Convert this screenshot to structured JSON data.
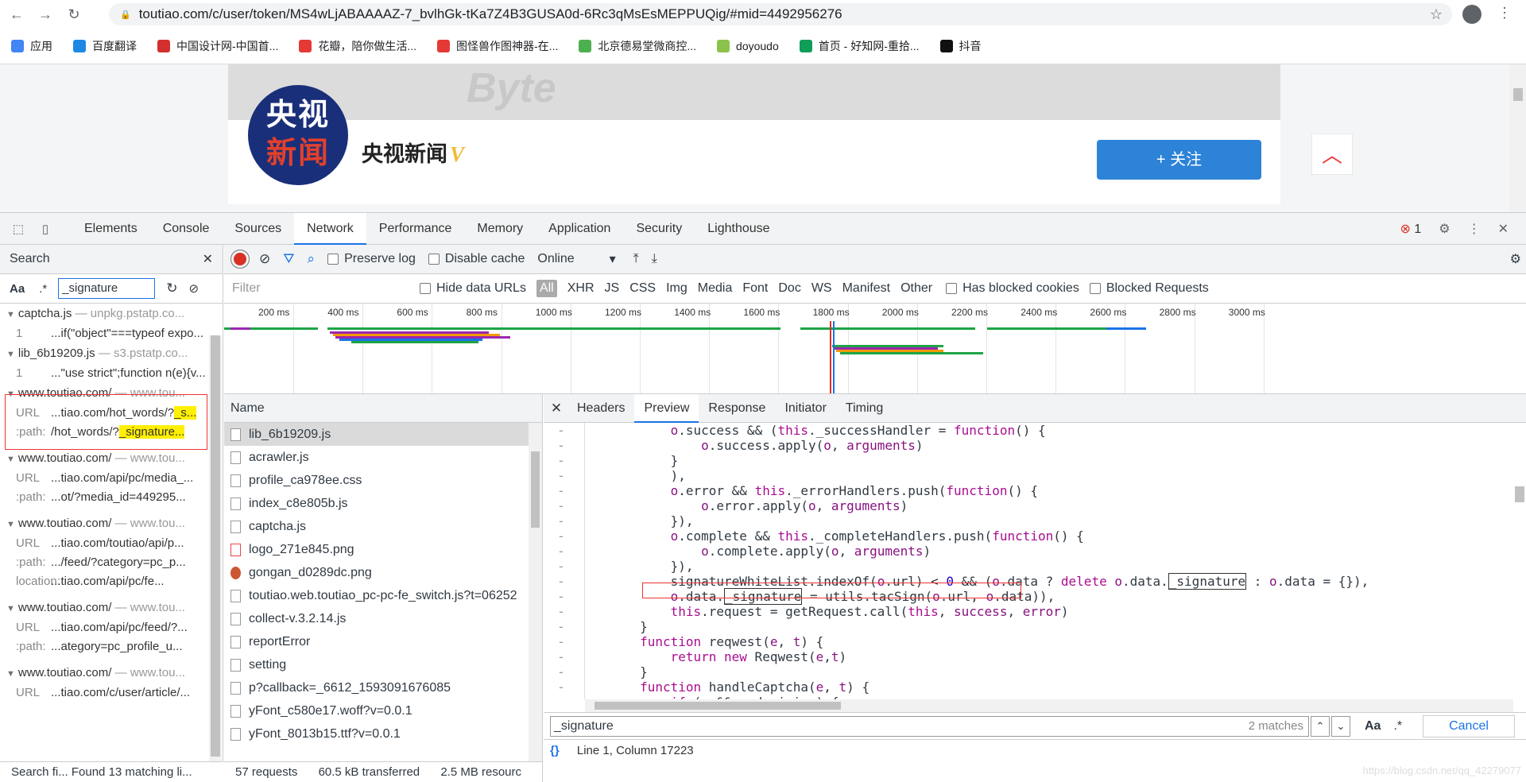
{
  "browser": {
    "url": "toutiao.com/c/user/token/MS4wLjABAAAAZ-7_bvlhGk-tKa7Z4B3GUSA0d-6Rc3qMsEsMEPPUQig/#mid=4492956276",
    "bookmarks": [
      "应用",
      "百度翻译",
      "中国设计网-中国首...",
      "花瓣，陪你做生活...",
      "图怪兽作图神器-在...",
      "北京德易堂微商控...",
      "doyoudo",
      "首页 - 好知网-重拾...",
      "抖音"
    ],
    "bookmark_colors": [
      "#4285f4",
      "#1e88e5",
      "#d32f2f",
      "#e53935",
      "#e53935",
      "#4caf50",
      "#8bc34a",
      "#0f9d58",
      "#111111"
    ]
  },
  "page": {
    "banner_wm": "Byte",
    "logo": {
      "line1": "央视",
      "line2": "新闻"
    },
    "account_name": "央视新闻",
    "verified": "V",
    "follow_label": "+ 关注",
    "top_icon": "chevron-up-icon"
  },
  "devtools": {
    "tabs": [
      "Elements",
      "Console",
      "Sources",
      "Network",
      "Performance",
      "Memory",
      "Application",
      "Security",
      "Lighthouse"
    ],
    "active_tab": "Network",
    "error_count": "1",
    "search": {
      "title": "Search",
      "aa": "Aa",
      "regex": ".*",
      "query": "_signature",
      "status": "Search fi...   Found 13 matching li...",
      "results": [
        {
          "file": "captcha.js",
          "src": "— unpkg.pstatp.co...",
          "lines": [
            {
              "k": "1",
              "v": "...if(\"object\"===typeof expo..."
            }
          ]
        },
        {
          "file": "lib_6b19209.js",
          "src": "— s3.pstatp.co...",
          "lines": [
            {
              "k": "1",
              "v": "...\"use strict\";function n(e){v..."
            }
          ]
        },
        {
          "file": "www.toutiao.com/",
          "src": "— www.tou...",
          "lines": [
            {
              "k": "URL",
              "v": "...tiao.com/hot_words/?",
              "h": "_s..."
            },
            {
              "k": ":path:",
              "v": "/hot_words/?",
              "h": "_signature..."
            }
          ]
        },
        {
          "file": "www.toutiao.com/",
          "src": "— www.tou...",
          "lines": [
            {
              "k": "URL",
              "v": "...tiao.com/api/pc/media_..."
            },
            {
              "k": ":path:",
              "v": "...ot/?media_id=449295..."
            }
          ]
        },
        {
          "file": "www.toutiao.com/",
          "src": "— www.tou...",
          "lines": [
            {
              "k": "URL",
              "v": "...tiao.com/toutiao/api/p..."
            },
            {
              "k": ":path:",
              "v": ".../feed/?category=pc_p..."
            },
            {
              "k": "location:",
              "v": "...tiao.com/api/pc/fe..."
            }
          ]
        },
        {
          "file": "www.toutiao.com/",
          "src": "— www.tou...",
          "lines": [
            {
              "k": "URL",
              "v": "...tiao.com/api/pc/feed/?..."
            },
            {
              "k": ":path:",
              "v": "...ategory=pc_profile_u..."
            }
          ]
        },
        {
          "file": "www.toutiao.com/",
          "src": "— www.tou...",
          "lines": [
            {
              "k": "URL",
              "v": "...tiao.com/c/user/article/..."
            }
          ]
        }
      ]
    },
    "network": {
      "preserve_log": "Preserve log",
      "disable_cache": "Disable cache",
      "throttle": "Online",
      "filter_placeholder": "Filter",
      "hide_data_urls": "Hide data URLs",
      "filters": [
        "All",
        "XHR",
        "JS",
        "CSS",
        "Img",
        "Media",
        "Font",
        "Doc",
        "WS",
        "Manifest",
        "Other"
      ],
      "has_blocked": "Has blocked cookies",
      "blocked_requests": "Blocked Requests",
      "ticks": [
        "200 ms",
        "400 ms",
        "600 ms",
        "800 ms",
        "1000 ms",
        "1200 ms",
        "1400 ms",
        "1600 ms",
        "1800 ms",
        "2000 ms",
        "2200 ms",
        "2400 ms",
        "2600 ms",
        "2800 ms",
        "3000 ms"
      ],
      "name_header": "Name",
      "requests": [
        "lib_6b19209.js",
        "acrawler.js",
        "profile_ca978ee.css",
        "index_c8e805b.js",
        "captcha.js",
        "logo_271e845.png",
        "gongan_d0289dc.png",
        "toutiao.web.toutiao_pc-pc-fe_switch.js?t=06252",
        "collect-v.3.2.14.js",
        "reportError",
        "setting",
        "p?callback=_6612_1593091676085",
        "yFont_c580e17.woff?v=0.0.1",
        "yFont_8013b15.ttf?v=0.0.1"
      ],
      "status": {
        "requests": "57 requests",
        "transferred": "60.5 kB transferred",
        "resources": "2.5 MB resourc"
      },
      "preview_tabs": [
        "Headers",
        "Preview",
        "Response",
        "Initiator",
        "Timing"
      ],
      "active_preview": "Preview",
      "find": {
        "query": "_signature",
        "matches": "2 matches",
        "aa": "Aa",
        "regex": ".*",
        "cancel": "Cancel"
      },
      "cursor": "Line 1, Column 17223",
      "braces": "{}"
    }
  },
  "watermark": "https://blog.csdn.net/qq_42279077"
}
